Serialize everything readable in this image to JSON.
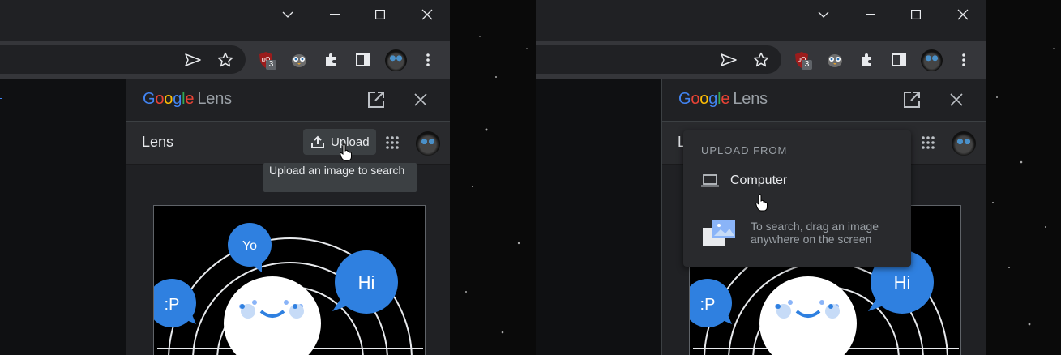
{
  "colors": {
    "google_blue": "#4285F4",
    "google_red": "#EA4335",
    "google_yellow": "#FBBC05",
    "google_green": "#34A853",
    "bubble_blue": "#2f80e0"
  },
  "browser": {
    "ublock_badge": "3"
  },
  "lens": {
    "logo_text": "Google",
    "logo_suffix": "Lens",
    "bar_title": "Lens",
    "upload_label": "Upload",
    "upload_tooltip": "Upload an image to search"
  },
  "illustration": {
    "bubble_yo": "Yo",
    "bubble_hi": "Hi",
    "bubble_p": ":P"
  },
  "upload_menu": {
    "title": "UPLOAD FROM",
    "computer_label": "Computer",
    "drag_hint": "To search, drag an image anywhere on the screen"
  }
}
